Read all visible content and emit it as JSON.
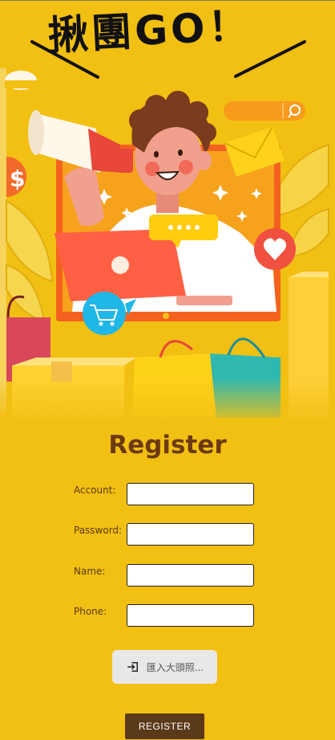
{
  "hero": {
    "title": "揪團GO！",
    "icons": [
      "megaphone-icon",
      "dollar-icon",
      "envelope-icon",
      "heart-icon",
      "cart-icon",
      "search-icon",
      "chat-bubble-icon",
      "laptop-icon"
    ]
  },
  "form": {
    "title": "Register",
    "fields": [
      {
        "label": "Account:",
        "value": ""
      },
      {
        "label": "Password:",
        "value": ""
      },
      {
        "label": "Name:",
        "value": ""
      },
      {
        "label": "Phone:",
        "value": ""
      }
    ],
    "upload_label": "匯入大頭照...",
    "submit_label": "REGISTER"
  },
  "colors": {
    "background": "#F2BF13",
    "title": "#6B3A12",
    "submit": "#5B3A1A"
  }
}
